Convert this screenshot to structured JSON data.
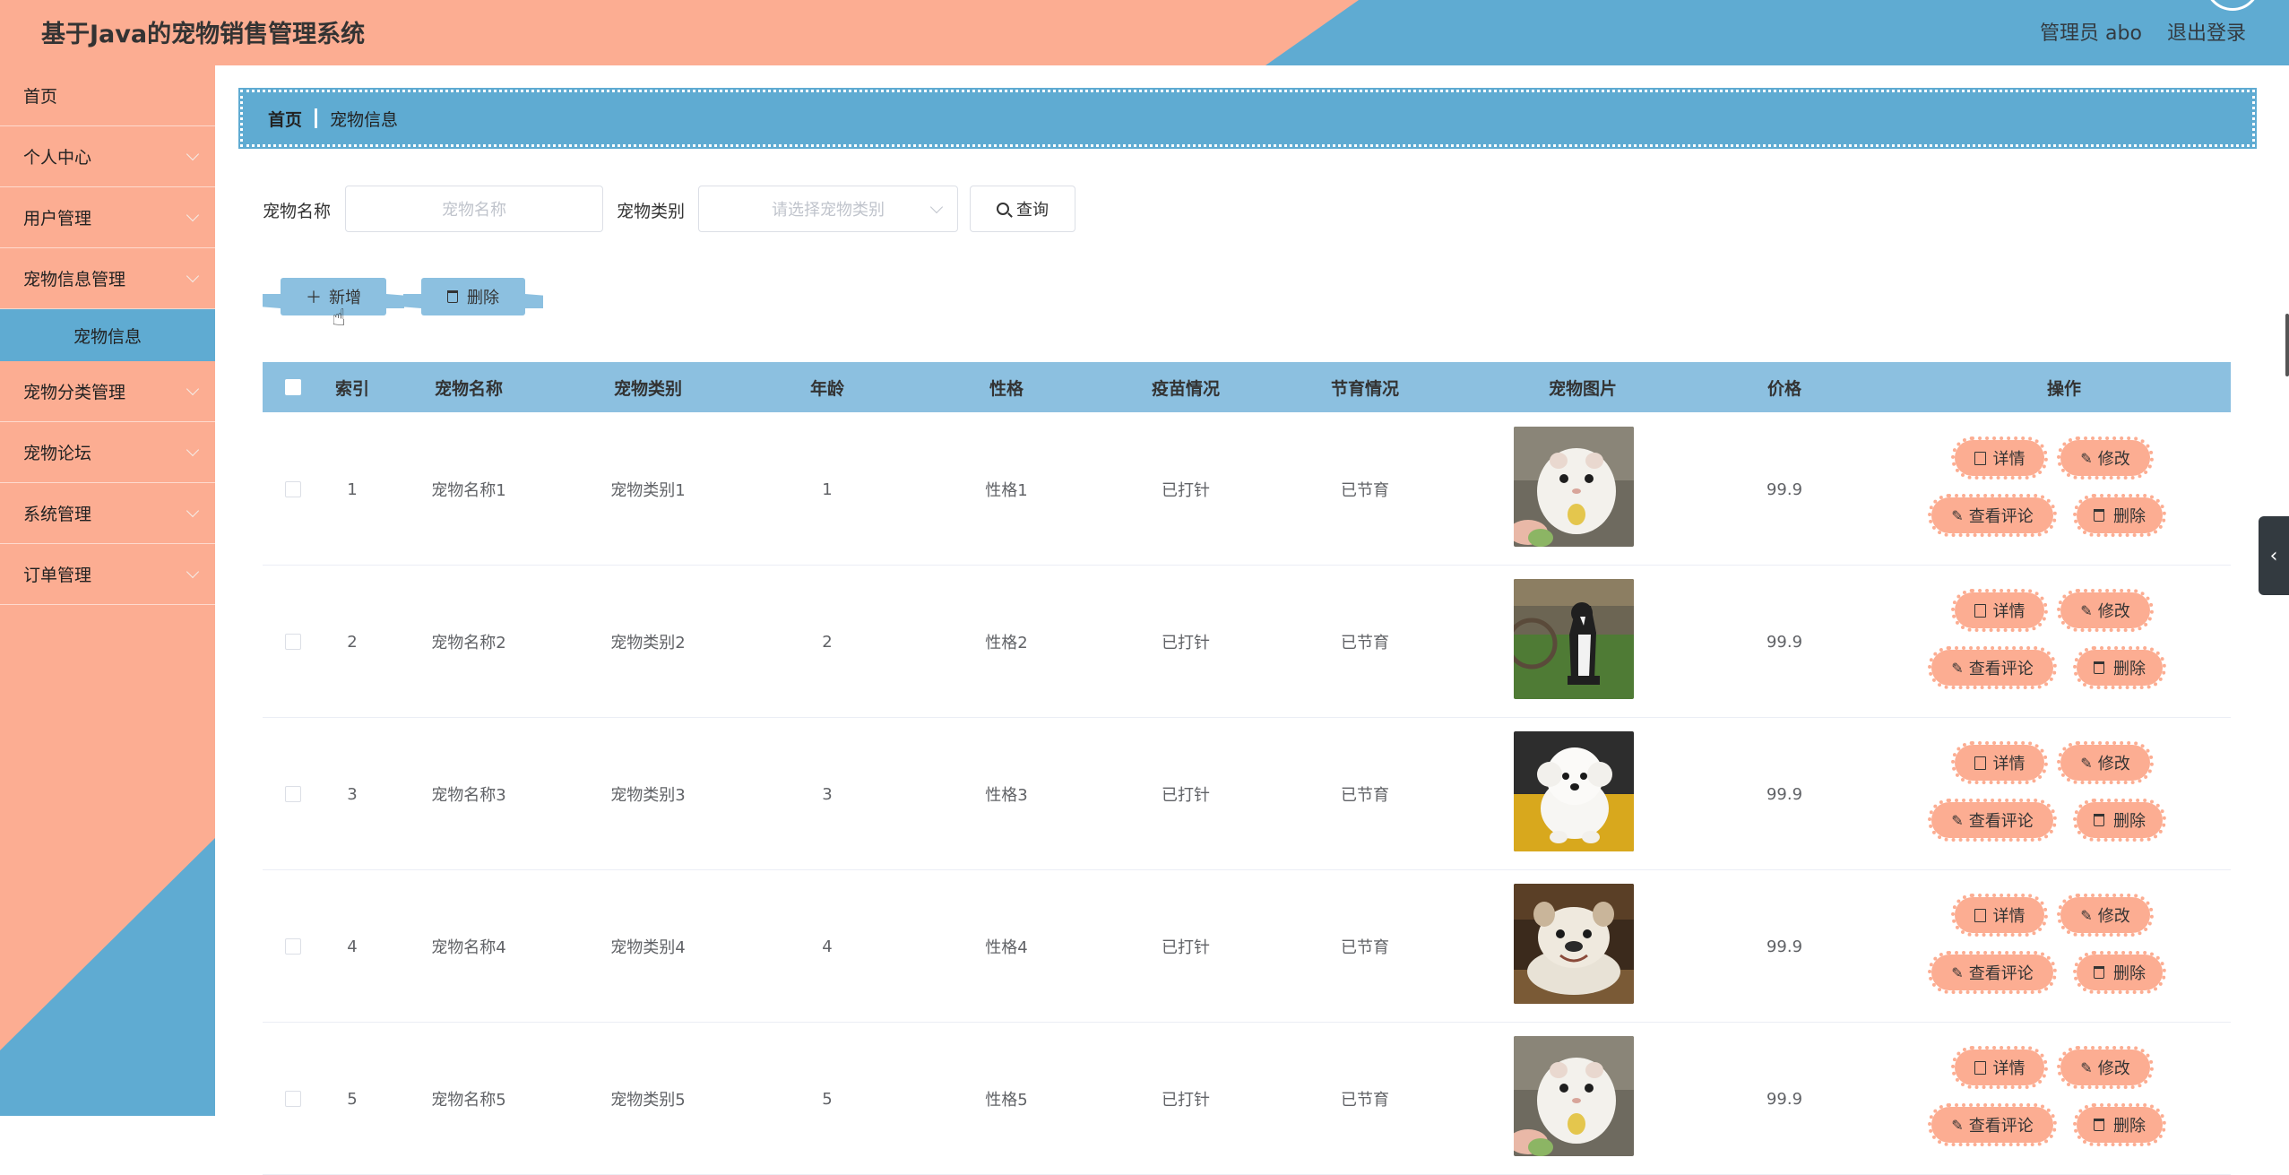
{
  "header": {
    "title": "基于Java的宠物销售管理系统",
    "admin": "管理员 abo",
    "logout": "退出登录"
  },
  "sidebar": {
    "items": [
      {
        "label": "首页",
        "has_children": false
      },
      {
        "label": "个人中心",
        "has_children": true
      },
      {
        "label": "用户管理",
        "has_children": true
      },
      {
        "label": "宠物信息管理",
        "has_children": true
      },
      {
        "label": "宠物分类管理",
        "has_children": true
      },
      {
        "label": "宠物论坛",
        "has_children": true
      },
      {
        "label": "系统管理",
        "has_children": true
      },
      {
        "label": "订单管理",
        "has_children": true
      }
    ],
    "active_sub": "宠物信息"
  },
  "breadcrumb": {
    "home": "首页",
    "current": "宠物信息"
  },
  "search": {
    "name_label": "宠物名称",
    "name_placeholder": "宠物名称",
    "category_label": "宠物类别",
    "category_placeholder": "请选择宠物类别",
    "search_btn": "查询"
  },
  "actions": {
    "add": "新增",
    "delete": "删除"
  },
  "table": {
    "columns": [
      "索引",
      "宠物名称",
      "宠物类别",
      "年龄",
      "性格",
      "疫苗情况",
      "节育情况",
      "宠物图片",
      "价格",
      "操作"
    ],
    "ops": {
      "detail": "详情",
      "edit": "修改",
      "comments": "查看评论",
      "delete": "删除"
    },
    "rows": [
      {
        "index": "1",
        "name": "宠物名称1",
        "category": "宠物类别1",
        "age": "1",
        "personality": "性格1",
        "vaccine": "已打针",
        "sterilized": "已节育",
        "image": "hamster",
        "price": "99.9"
      },
      {
        "index": "2",
        "name": "宠物名称2",
        "category": "宠物类别2",
        "age": "2",
        "personality": "性格2",
        "vaccine": "已打针",
        "sterilized": "已节育",
        "image": "border-collie",
        "price": "99.9"
      },
      {
        "index": "3",
        "name": "宠物名称3",
        "category": "宠物类别3",
        "age": "3",
        "personality": "性格3",
        "vaccine": "已打针",
        "sterilized": "已节育",
        "image": "bichon",
        "price": "99.9"
      },
      {
        "index": "4",
        "name": "宠物名称4",
        "category": "宠物类别4",
        "age": "4",
        "personality": "性格4",
        "vaccine": "已打针",
        "sterilized": "已节育",
        "image": "bulldog",
        "price": "99.9"
      },
      {
        "index": "5",
        "name": "宠物名称5",
        "category": "宠物类别5",
        "age": "5",
        "personality": "性格5",
        "vaccine": "已打针",
        "sterilized": "已节育",
        "image": "hamster",
        "price": "99.9"
      }
    ]
  },
  "colors": {
    "salmon": "#fcad92",
    "blue": "#5fabd2",
    "light_blue": "#8cc0e0"
  }
}
